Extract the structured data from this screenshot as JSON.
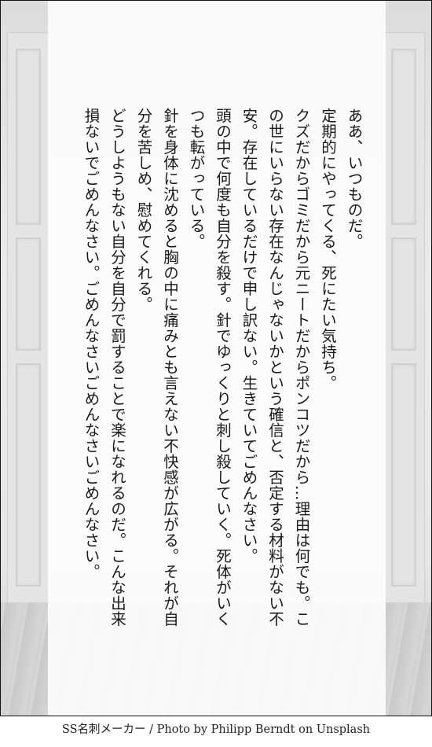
{
  "paragraphs": [
    "ああ、いつものだ。",
    "定期的にやってくる、死にたい気持ち。",
    "クズだからゴミだから元ニートだからポンコツだから…理由は何でも。この世にいらない存在なんじゃないかという確信と、否定する材料がない不安。存在しているだけで申し訳ない。生きていてごめんなさい。",
    "頭の中で何度も自分を殺す。針でゆっくりと刺し殺していく。死体がいくつも転がっている。",
    "針を身体に沈めると胸の中に痛みとも言えない不快感が広がる。それが自分を苦しめ、慰めてくれる。",
    "どうしようもない自分を自分で罰することで楽になれるのだ。こんな出来損ないでごめんなさい。ごめんなさいごめんなさいごめんなさい。"
  ],
  "credit": "SS名刺メーカー / Photo by Philipp Berndt on Unsplash"
}
